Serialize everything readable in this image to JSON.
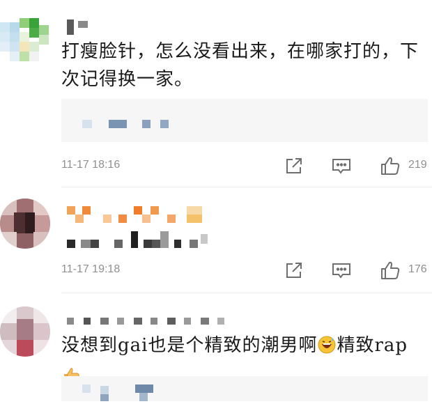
{
  "comments": [
    {
      "text": "打瘦脸针，怎么没看出来，在哪家打的，下次记得换一家。",
      "time": "11-17 18:16",
      "likes": "219"
    },
    {
      "text": "",
      "time": "11-17 19:18",
      "likes": "176"
    },
    {
      "text_before": "没想到gai也是个精致的潮男啊",
      "text_middle": "精致rap",
      "icons": [
        "grinning-sweat-emoji",
        "thumbs-up-emoji"
      ]
    }
  ],
  "icons": {
    "share": "share-icon",
    "comment": "comment-icon",
    "like": "thumbs-up-icon"
  }
}
